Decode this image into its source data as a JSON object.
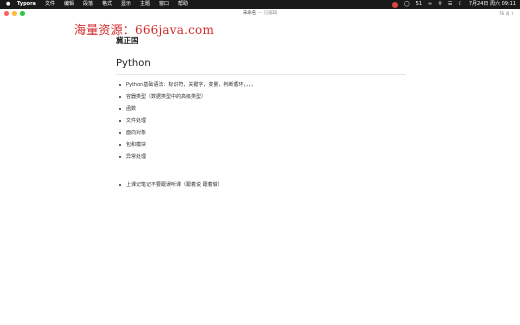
{
  "menubar": {
    "apple": "",
    "app_name": "Typora",
    "menus": [
      "文件",
      "编辑",
      "段落",
      "格式",
      "显示",
      "主题",
      "窗口",
      "帮助"
    ],
    "status_count": "51",
    "datetime": "7月24日 周六 09:11"
  },
  "window": {
    "title": "未命名",
    "edited": "— 已编辑",
    "right_label": "76 词 ↑"
  },
  "watermark": "海量资源：666java.com",
  "document": {
    "author": "冀正国",
    "heading": "Python",
    "items": [
      "Python基础语法：标识符，关键字，变量，判断循环，，，，",
      "容器类型（数据类型中的高级类型）",
      "函数",
      "文件处理",
      "面向对象",
      "包和模块",
      "异常处理"
    ],
    "note_items": [
      "上课记笔记不要跟误听课（跟着说 跟着做）"
    ]
  },
  "colors": {
    "menubar_bg": "#1a1a1a",
    "traffic_red": "#ff5f57",
    "traffic_yellow": "#febc2e",
    "traffic_green": "#28c840",
    "watermark": "#d22a2a"
  }
}
